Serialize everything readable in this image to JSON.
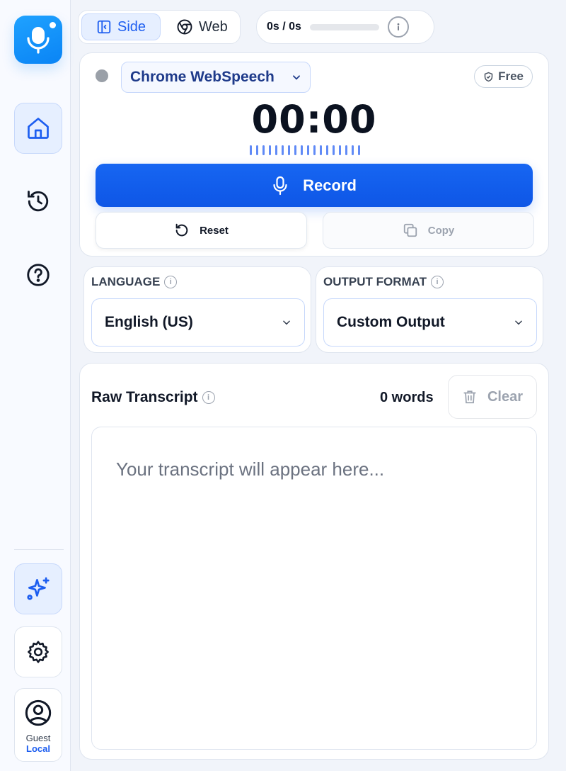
{
  "sidebar": {
    "guest_name": "Guest",
    "guest_mode": "Local",
    "items": [
      "home-icon",
      "history-icon",
      "help-icon"
    ],
    "bottom_items": [
      "sparkles-icon",
      "gear-icon",
      "user-icon"
    ]
  },
  "top": {
    "toggle": {
      "side": "Side",
      "web": "Web",
      "active": "side"
    },
    "timer": "0s / 0s",
    "usage_progress": 0
  },
  "recorder": {
    "engine": "Chrome WebSpeech",
    "badge": "Free",
    "clock": "00:00",
    "record_label": "Record",
    "reset_label": "Reset",
    "copy_label": "Copy"
  },
  "language": {
    "label": "LANGUAGE",
    "value": "English (US)"
  },
  "output_format": {
    "label": "OUTPUT FORMAT",
    "value": "Custom Output"
  },
  "transcript": {
    "title": "Raw Transcript",
    "word_count": "0 words",
    "clear_label": "Clear",
    "placeholder": "Your transcript will appear here..."
  },
  "colors": {
    "accent": "#1766f2",
    "accent_dark": "#1e3a8a",
    "muted": "#9ca3af",
    "background": "#f1f4fa"
  }
}
